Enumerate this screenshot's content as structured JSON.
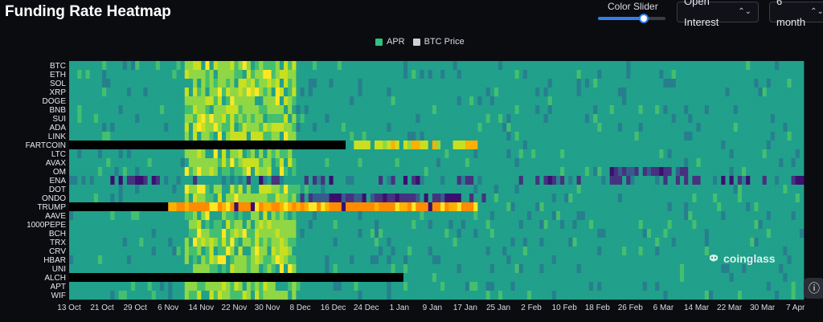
{
  "header": {
    "title": "Funding Rate Heatmap",
    "slider_label": "Color Slider",
    "slider_value": 0.68,
    "metric_select": "Open Interest",
    "range_select": "6 month"
  },
  "watermark": "coinglass",
  "colors": {
    "background": "#0b0c10",
    "base": "#21a08b",
    "accent_select": "#2f7ff0",
    "no_data": "#000000",
    "low": "#3b0f70",
    "high": "#ff8c00"
  },
  "chart_data": {
    "type": "heatmap",
    "title": "Funding Rate Heatmap",
    "legend": [
      {
        "name": "APR",
        "color": "#2ec27e"
      },
      {
        "name": "BTC Price",
        "color": "#d0d0d0"
      }
    ],
    "legend_position": "top-center",
    "grid": false,
    "rows": [
      "BTC",
      "ETH",
      "SOL",
      "XRP",
      "DOGE",
      "BNB",
      "SUI",
      "ADA",
      "LINK",
      "FARTCOIN",
      "LTC",
      "AVAX",
      "OM",
      "ENA",
      "DOT",
      "ONDO",
      "TRUMP",
      "AAVE",
      "1000PEPE",
      "BCH",
      "TRX",
      "CRV",
      "HBAR",
      "UNI",
      "ALCH",
      "APT",
      "WIF"
    ],
    "x_ticks": [
      "13 Oct",
      "21 Oct",
      "29 Oct",
      "6 Nov",
      "14 Nov",
      "22 Nov",
      "30 Nov",
      "8 Dec",
      "16 Dec",
      "24 Dec",
      "1 Jan",
      "9 Jan",
      "17 Jan",
      "25 Jan",
      "2 Feb",
      "10 Feb",
      "18 Feb",
      "26 Feb",
      "6 Mar",
      "14 Mar",
      "22 Mar",
      "30 Mar",
      "7 Apr"
    ],
    "x_range": [
      "2024-10-13",
      "2025-04-09"
    ],
    "missing_data_until": [
      {
        "row": "FARTCOIN",
        "until": "2024-12-19"
      },
      {
        "row": "TRUMP",
        "until": "2024-11-06"
      },
      {
        "row": "ALCH",
        "until": "2025-01-02"
      }
    ],
    "high_intensity_periods": [
      "2024-11-10 to 2024-12-07"
    ],
    "notable": [
      {
        "row": "TRUMP",
        "range": "2024-11-06 to 2025-01-20",
        "level": "high"
      },
      {
        "row": "FARTCOIN",
        "range": "2024-12-19 to 2025-01-20",
        "level": "elevated"
      },
      {
        "row": "ENA",
        "range": "2024-10-13 to 2025-04-09",
        "level": "often low"
      },
      {
        "row": "ONDO",
        "range": "2024-12-08 to 2025-01-22",
        "level": "low"
      },
      {
        "row": "OM",
        "range": "2025-02-20 to 2025-03-12",
        "level": "low"
      }
    ]
  }
}
